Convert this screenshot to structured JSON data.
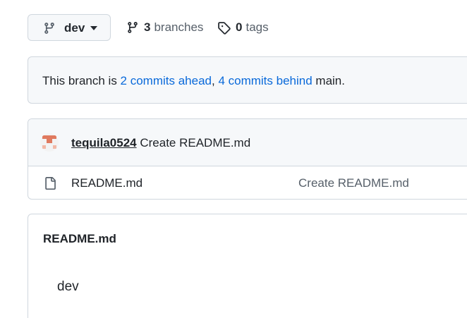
{
  "toolbar": {
    "branch_label": "dev",
    "branches_count": "3",
    "branches_label": "branches",
    "tags_count": "0",
    "tags_label": "tags"
  },
  "status": {
    "prefix": "This branch is ",
    "ahead_link": "2 commits ahead",
    "separator": ", ",
    "behind_link": "4 commits behind",
    "suffix": " main."
  },
  "latest_commit": {
    "author": "tequila0524",
    "message": "Create README.md"
  },
  "files": [
    {
      "name": "README.md",
      "last_commit": "Create README.md",
      "icon": "file-icon"
    }
  ],
  "readme": {
    "title": "README.md",
    "body": "dev"
  },
  "colors": {
    "link": "#0969da",
    "border": "#d0d7de",
    "muted_bg": "#f6f8fa",
    "muted_text": "#57606a",
    "avatar_accent": "#e07a5f"
  }
}
